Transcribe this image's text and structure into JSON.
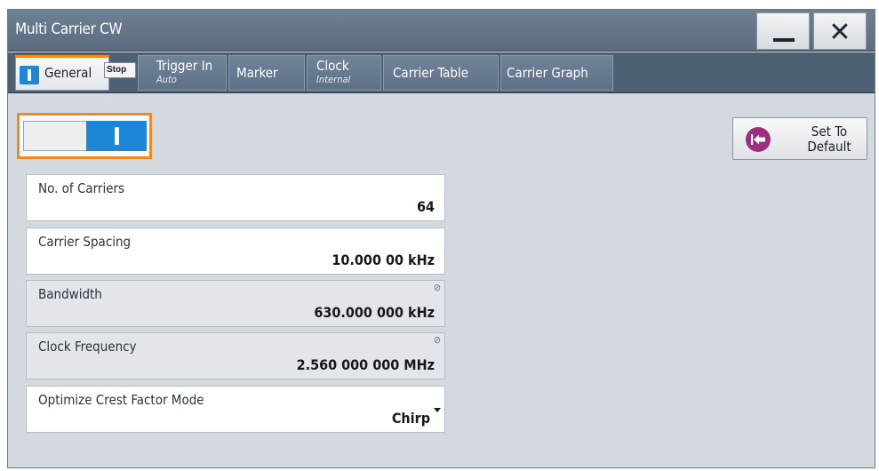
{
  "window": {
    "title": "Multi Carrier CW",
    "minimize_icon": "minimize-icon",
    "close_icon": "close-icon",
    "close_glyph": "✕"
  },
  "tabs": [
    {
      "label": "General",
      "sub": "",
      "active": true
    },
    {
      "label": "Trigger In",
      "sub": "Auto",
      "badge": "Stop",
      "active": false
    },
    {
      "label": "Marker",
      "sub": "",
      "active": false
    },
    {
      "label": "Clock",
      "sub": "Internal",
      "active": false
    },
    {
      "label": "Carrier Table",
      "sub": "",
      "active": false
    },
    {
      "label": "Carrier Graph",
      "sub": "",
      "active": false
    }
  ],
  "state": {
    "enabled": true
  },
  "set_to_default": {
    "line1": "Set To",
    "line2": "Default",
    "icon": "back-arrow-icon"
  },
  "fields": {
    "carriers": {
      "label": "No. of Carriers",
      "value": "64"
    },
    "spacing": {
      "label": "Carrier Spacing",
      "value": "10.000 00 kHz"
    },
    "bandwidth": {
      "label": "Bandwidth",
      "value": "630.000 000 kHz",
      "readonly_icon": "⊘"
    },
    "clock_freq": {
      "label": "Clock Frequency",
      "value": "2.560 000 000 MHz",
      "readonly_icon": "⊘"
    },
    "crest": {
      "label": "Optimize Crest Factor Mode",
      "value": "Chirp"
    }
  },
  "colors": {
    "accent_orange": "#f08a1e",
    "toggle_blue": "#1e86d6",
    "default_icon": "#9a2e7f",
    "titlebar": "#5b6c80"
  }
}
